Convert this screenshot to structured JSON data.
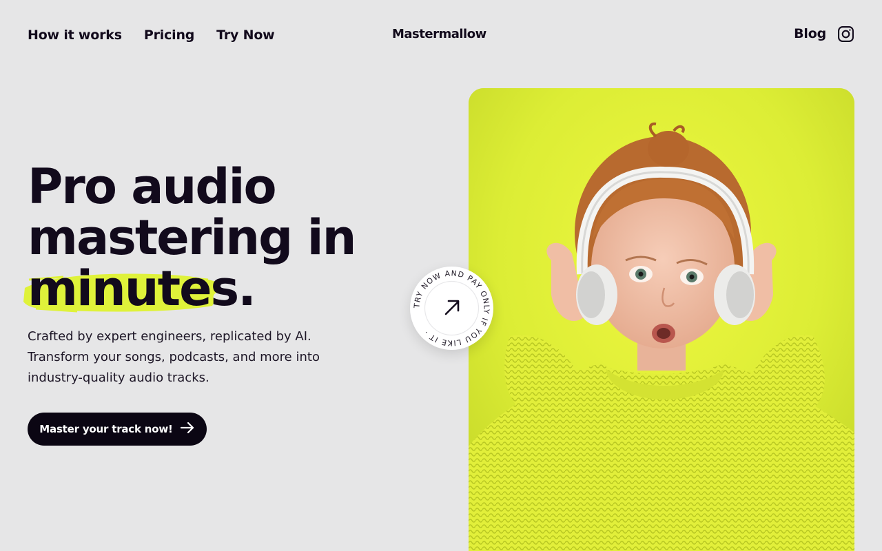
{
  "nav": {
    "links": [
      {
        "label": "How it works"
      },
      {
        "label": "Pricing"
      },
      {
        "label": "Try Now"
      }
    ],
    "logo": "Mastermallow",
    "blog": "Blog",
    "instagram_icon": "instagram-icon"
  },
  "hero": {
    "headline_line1": "Pro audio",
    "headline_line2": "mastering in",
    "headline_highlight": "minutes",
    "headline_period": ".",
    "subtitle": "Crafted by expert engineers, replicated by AI. Transform your songs, podcasts, and more into industry-quality audio tracks.",
    "cta_label": "Master your track now!",
    "cta_icon": "arrow-right-icon"
  },
  "badge": {
    "text": "TRY NOW AND PAY ONLY IF YOU LIKE IT · ",
    "icon": "arrow-up-right-icon"
  },
  "colors": {
    "background": "#e6e6e7",
    "ink": "#120a1c",
    "accent": "#dcf034",
    "cta": "#0b0613"
  }
}
